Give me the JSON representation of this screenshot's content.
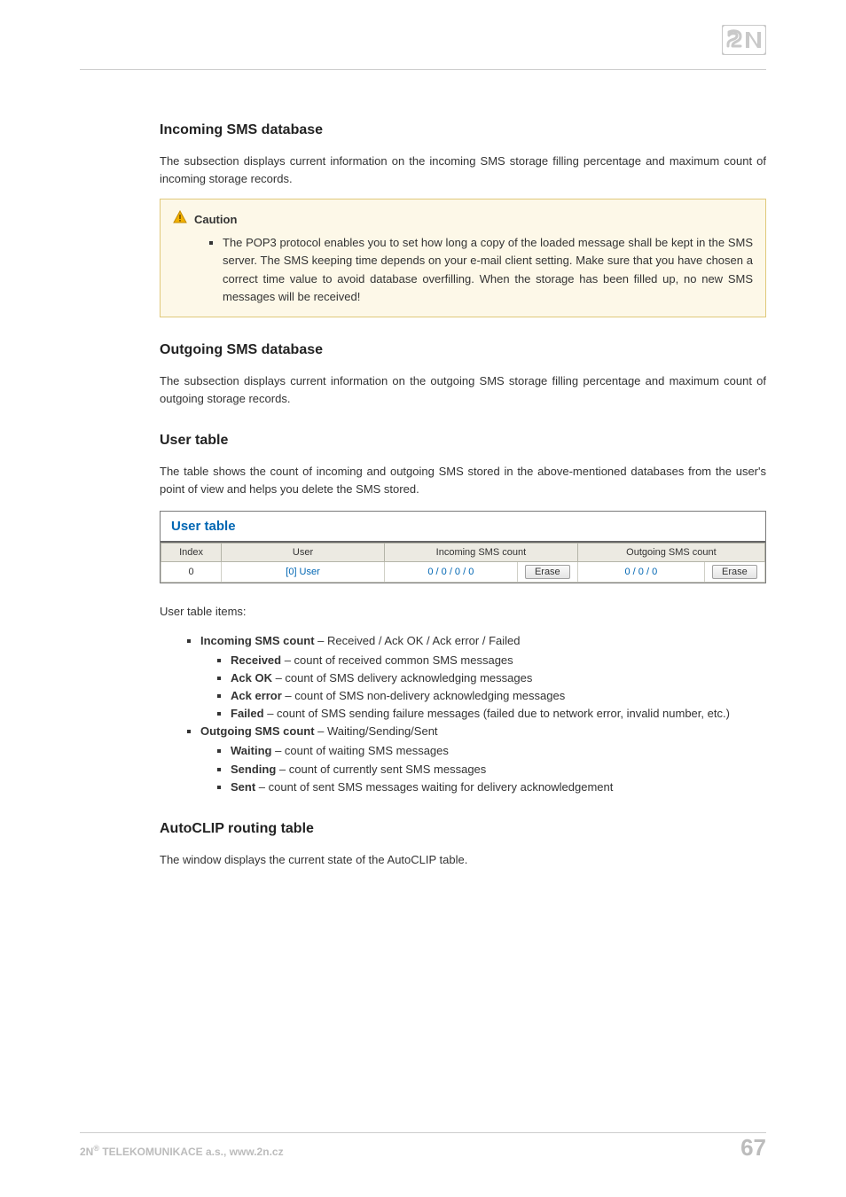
{
  "headings": {
    "incoming_db": "Incoming SMS database",
    "outgoing_db": "Outgoing SMS database",
    "user_table": "User table",
    "autoclip": "AutoCLIP routing table"
  },
  "paragraphs": {
    "incoming_db": "The subsection displays current information on the incoming SMS storage filling percentage and maximum count of incoming storage records.",
    "outgoing_db": "The subsection displays current information on the outgoing SMS storage filling percentage and maximum count of outgoing storage records.",
    "user_table": "The table shows the count of incoming and outgoing SMS stored in the above-mentioned databases from the user's point of view and helps you delete the SMS stored.",
    "user_table_items_intro": "User table items:",
    "autoclip": "The window displays the current state of the AutoCLIP table."
  },
  "caution": {
    "label": "Caution",
    "text": "The POP3 protocol enables you to set how long a copy of the loaded message shall be kept in the SMS server. The SMS keeping time depends on your e-mail client setting. Make sure that you have chosen a correct time value to avoid database overfilling. When the storage has been filled up, no new SMS messages will be received!"
  },
  "user_table_widget": {
    "title": "User table",
    "columns": {
      "index": "Index",
      "user": "User",
      "incoming": "Incoming SMS count",
      "outgoing": "Outgoing SMS count"
    },
    "rows": [
      {
        "index": "0",
        "user": "[0] User",
        "incoming": "0 / 0 / 0 / 0",
        "erase_in": "Erase",
        "outgoing": "0 / 0 / 0",
        "erase_out": "Erase"
      }
    ]
  },
  "items": {
    "incoming_sms_count_label": "Incoming SMS count",
    "incoming_sms_count_desc": " – Received / Ack OK / Ack error / Failed",
    "received_label": "Received",
    "received_desc": " – count of received common SMS messages",
    "ack_ok_label": "Ack OK",
    "ack_ok_desc": " – count of SMS delivery acknowledging messages",
    "ack_error_label": "Ack error",
    "ack_error_desc": " – count of SMS non-delivery acknowledging messages",
    "failed_label": "Failed",
    "failed_desc": " – count of SMS sending failure messages (failed due to network error, invalid number, etc.)",
    "outgoing_sms_count_label": "Outgoing SMS count",
    "outgoing_sms_count_desc": "  – Waiting/Sending/Sent",
    "waiting_label": "Waiting",
    "waiting_desc": " – count of waiting SMS messages",
    "sending_label": "Sending",
    "sending_desc": " – count of currently sent SMS messages",
    "sent_label": "Sent",
    "sent_desc": " – count of sent SMS messages waiting for delivery acknowledgement"
  },
  "footer": {
    "company_prefix": "2N",
    "company_sup": "®",
    "company_rest": " TELEKOMUNIKACE a.s., www.2n.cz",
    "page_number": "67"
  }
}
